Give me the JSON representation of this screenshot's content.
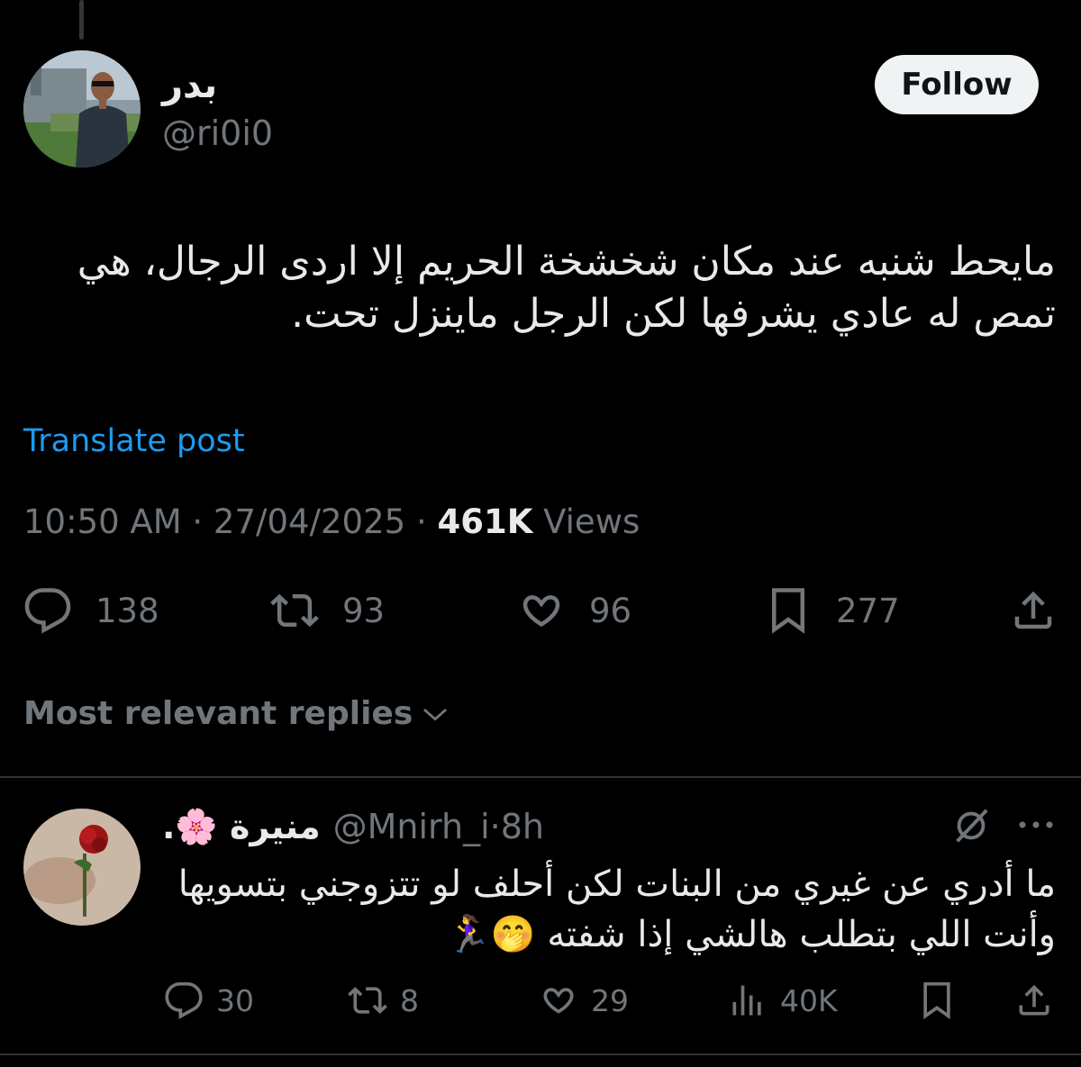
{
  "post": {
    "display_name": "بدر",
    "handle": "@ri0i0",
    "follow_label": "Follow",
    "text_line1": "مايحط شنبه عند مكان شخشخة الحريم إلا اردى الرجال، هي",
    "text_line2": "تمص له عادي يشرفها لكن الرجل ماينزل تحت.",
    "translate_label": "Translate post",
    "time": "10:50 AM",
    "date": "27/04/2025",
    "views_count": "461K",
    "views_label": "Views",
    "separator": "·",
    "replies": "138",
    "reposts": "93",
    "likes": "96",
    "bookmarks": "277"
  },
  "sort": {
    "label": "Most relevant replies"
  },
  "reply": {
    "display_name": "منيرة 🌸.",
    "handle": "@Mnirh_i",
    "time": "8h",
    "separator": "·",
    "text_line1": "ما أدري عن غيري من البنات لكن أحلف لو تتزوجني بتسويها",
    "text_line2": "وأنت اللي بتطلب هالشي إذا شفته 🤭🏃‍♀️",
    "replies": "30",
    "reposts": "8",
    "likes": "29",
    "views": "40K"
  },
  "colors": {
    "background": "#000000",
    "text": "#e7e9ea",
    "muted": "#71767b",
    "link": "#1d9bf0",
    "follow_bg": "#eff3f4"
  },
  "icons": [
    "reply-icon",
    "repost-icon",
    "like-icon",
    "bookmark-icon",
    "share-icon",
    "chevron-down-icon",
    "grok-icon",
    "more-icon",
    "views-icon"
  ]
}
